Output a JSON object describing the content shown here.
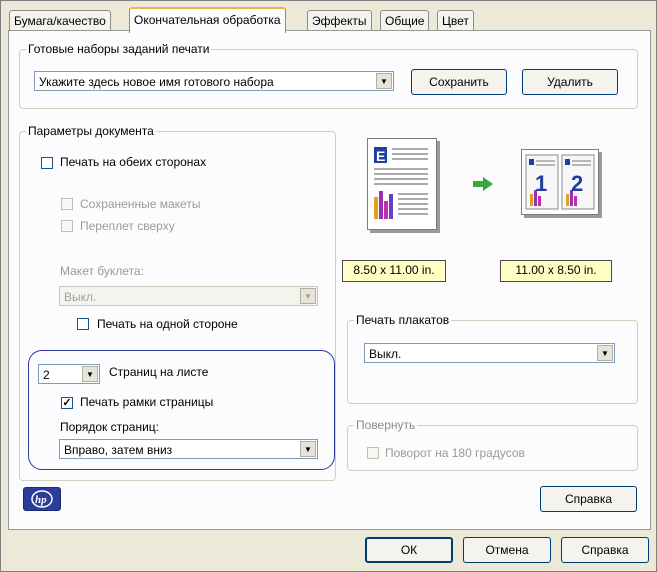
{
  "tabs": [
    {
      "label": "Бумага/качество"
    },
    {
      "label": "Окончательная обработка"
    },
    {
      "label": "Эффекты"
    },
    {
      "label": "Общие"
    },
    {
      "label": "Цвет"
    }
  ],
  "presets": {
    "legend": "Готовые наборы заданий печати",
    "combo_value": "Укажите здесь новое имя готового набора",
    "save_label": "Сохранить",
    "delete_label": "Удалить"
  },
  "document": {
    "legend": "Параметры документа",
    "duplex_label": "Печать на обеих сторонах",
    "duplex_checked": false,
    "saved_layouts_label": "Сохраненные макеты",
    "flip_top_label": "Переплет сверху",
    "booklet_label": "Макет буклета:",
    "booklet_value": "Выкл.",
    "one_side_label": "Печать на одной стороне",
    "pages_per_sheet_value": "2",
    "pages_per_sheet_label": "Страниц на листе",
    "print_borders_label": "Печать рамки страницы",
    "print_borders_checked": true,
    "page_order_label": "Порядок страниц:",
    "page_order_value": "Вправо, затем вниз"
  },
  "preview": {
    "source_size": "8.50 x 11.00 in.",
    "target_size": "11.00 x 8.50 in.",
    "page_letter": "E",
    "page_num_1": "1",
    "page_num_2": "2"
  },
  "poster": {
    "legend": "Печать плакатов",
    "value": "Выкл."
  },
  "rotate": {
    "legend": "Повернуть",
    "rotate_label": "Поворот на 180 градусов"
  },
  "logo_text": "hp",
  "help_inner_label": "Справка",
  "footer": {
    "ok_label": "ОК",
    "cancel_label": "Отмена",
    "help_label": "Справка"
  },
  "colors": {
    "accent_tab": "#f6b243",
    "highlight_outline": "#2f3aa0",
    "size_label_bg": "#ffffc4",
    "arrow": "#3aa83a"
  }
}
